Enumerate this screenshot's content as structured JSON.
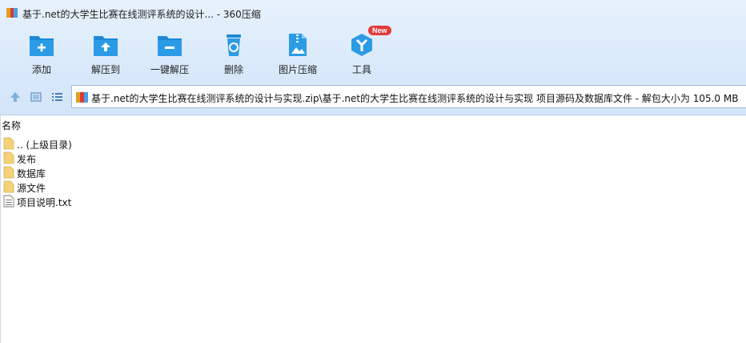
{
  "window": {
    "title": "基于.net的大学生比赛在线测评系统的设计... - 360压缩"
  },
  "toolbar": {
    "items": [
      {
        "label": "添加",
        "icon": "add-icon"
      },
      {
        "label": "解压到",
        "icon": "extract-to-icon"
      },
      {
        "label": "一键解压",
        "icon": "one-click-extract-icon"
      },
      {
        "label": "删除",
        "icon": "delete-icon"
      },
      {
        "label": "图片压缩",
        "icon": "image-compress-icon"
      },
      {
        "label": "工具",
        "icon": "tools-icon",
        "badge": "New"
      }
    ]
  },
  "nav": {
    "path": "基于.net的大学生比赛在线测评系统的设计与实现.zip\\基于.net的大学生比赛在线测评系统的设计与实现 项目源码及数据库文件 - 解包大小为 105.0 MB"
  },
  "filelist": {
    "header": "名称",
    "items": [
      {
        "name": ".. (上级目录)",
        "type": "folder"
      },
      {
        "name": "发布",
        "type": "folder"
      },
      {
        "name": "数据库",
        "type": "folder"
      },
      {
        "name": "源文件",
        "type": "folder"
      },
      {
        "name": "项目说明.txt",
        "type": "file"
      }
    ]
  },
  "colors": {
    "accent": "#1e8ad6",
    "toolbar_bg": "#dbeafa",
    "badge": "#e43a3a",
    "folder": "#f3d27a"
  }
}
